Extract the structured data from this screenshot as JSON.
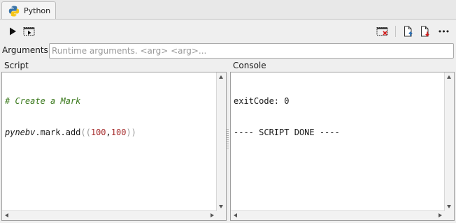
{
  "tab": {
    "label": "Python",
    "icon": "python-icon"
  },
  "toolbar": {
    "run_icon": "play-icon",
    "run_selection_icon": "run-in-window-icon",
    "clear_icon": "clear-console-icon",
    "import_icon": "import-file-icon",
    "export_icon": "export-file-icon",
    "more_icon": "more-icon",
    "more_glyph": "•••"
  },
  "arguments": {
    "label": "Arguments",
    "value": "",
    "placeholder": "Runtime arguments. <arg> <arg>..."
  },
  "script": {
    "label": "Script",
    "lines": {
      "comment": "# Create a Mark",
      "obj": "pynebv",
      "dot": ".",
      "call": "mark.add",
      "open": "((",
      "n1": "100",
      "comma": ",",
      "n2": "100",
      "close": "))"
    }
  },
  "console": {
    "label": "Console",
    "lines": [
      "exitCode: 0",
      "---- SCRIPT DONE ----"
    ]
  },
  "colors": {
    "comment": "#3c7a1e",
    "number": "#a52a2a",
    "paren": "#9a9a9a",
    "clear_x": "#d42020",
    "export_arrow": "#d42020",
    "import_arrow": "#2a6fb5"
  }
}
